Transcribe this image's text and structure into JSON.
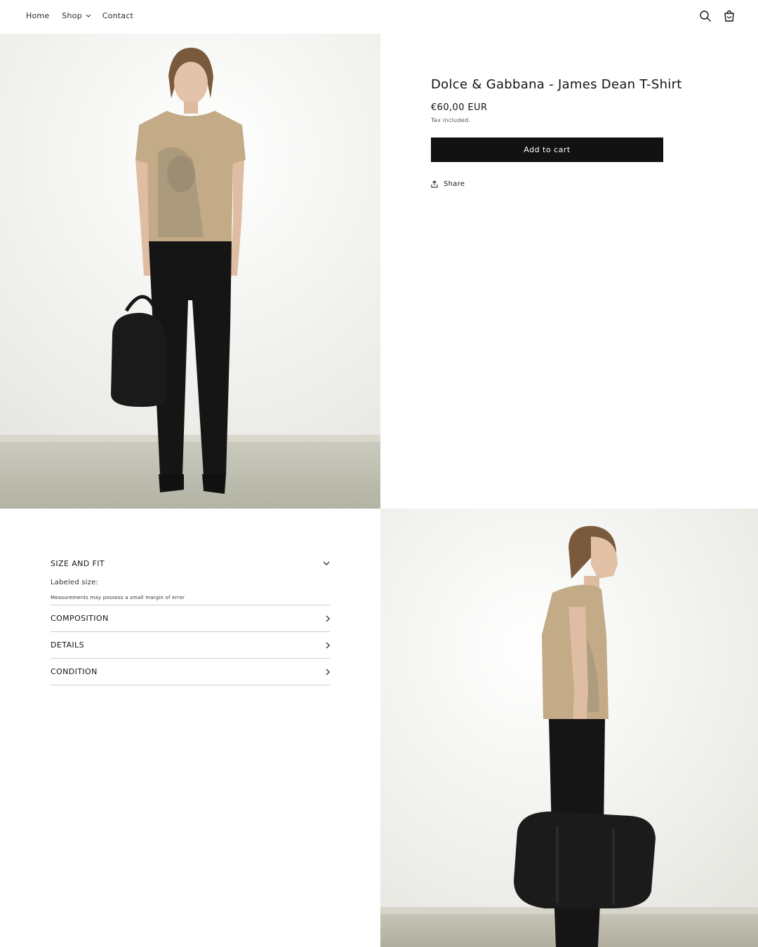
{
  "nav": {
    "home": "Home",
    "shop": "Shop",
    "contact": "Contact"
  },
  "header_icons": [
    "search-icon",
    "cart-icon"
  ],
  "product": {
    "title": "Dolce & Gabbana - James Dean T-Shirt",
    "price": "€60,00 EUR",
    "tax_note": "Tax included.",
    "add_to_cart": "Add to cart",
    "share": "Share"
  },
  "accordion": {
    "size_and_fit": {
      "title": "SIZE AND FIT",
      "labeled_size": "Labeled size:",
      "note": "Measurements may possess a small margin of error"
    },
    "items": [
      {
        "title": "COMPOSITION"
      },
      {
        "title": "DETAILS"
      },
      {
        "title": "CONDITION"
      }
    ]
  },
  "colors": {
    "button_bg": "#121212",
    "text": "#121212",
    "divider": "#cfcfcf",
    "tshirt": "#c2ab86",
    "trousers": "#151515"
  }
}
